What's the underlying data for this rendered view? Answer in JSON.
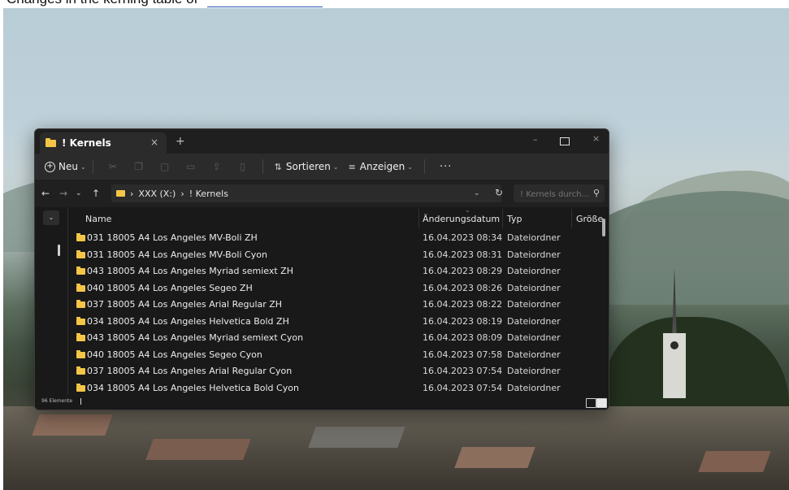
{
  "document": {
    "text": "Changes in the kerning table of"
  },
  "window": {
    "tab_title": "! Kernels",
    "tab_close": "×",
    "tab_add": "+",
    "minimize": "–",
    "close": "×"
  },
  "toolbar": {
    "new_label": "Neu",
    "sort_label": "Sortieren",
    "view_label": "Anzeigen",
    "more_label": "···"
  },
  "address": {
    "drive": "XXX (X:)",
    "folder": "! Kernels",
    "separator": "›",
    "search_placeholder": "! Kernels durch..."
  },
  "columns": {
    "name": "Name",
    "date": "Änderungsdatum",
    "type": "Typ",
    "size": "Größe"
  },
  "rows": [
    {
      "name": "031 18005 A4 Los Angeles MV-Boli ZH",
      "date": "16.04.2023 08:34",
      "type": "Dateiordner"
    },
    {
      "name": "031 18005 A4 Los Angeles MV-Boli Cyon",
      "date": "16.04.2023 08:31",
      "type": "Dateiordner"
    },
    {
      "name": "043 18005 A4 Los Angeles Myriad semiext ZH",
      "date": "16.04.2023 08:29",
      "type": "Dateiordner"
    },
    {
      "name": "040 18005 A4 Los Angeles Segeo ZH",
      "date": "16.04.2023 08:26",
      "type": "Dateiordner"
    },
    {
      "name": "037 18005 A4 Los Angeles Arial Regular ZH",
      "date": "16.04.2023 08:22",
      "type": "Dateiordner"
    },
    {
      "name": "034 18005 A4 Los Angeles Helvetica Bold ZH",
      "date": "16.04.2023 08:19",
      "type": "Dateiordner"
    },
    {
      "name": "043 18005 A4 Los Angeles Myriad semiext Cyon",
      "date": "16.04.2023 08:09",
      "type": "Dateiordner"
    },
    {
      "name": "040 18005 A4 Los Angeles Segeo Cyon",
      "date": "16.04.2023 07:58",
      "type": "Dateiordner"
    },
    {
      "name": "037 18005 A4 Los Angeles Arial Regular Cyon",
      "date": "16.04.2023 07:54",
      "type": "Dateiordner"
    },
    {
      "name": "034 18005 A4 Los Angeles Helvetica Bold Cyon",
      "date": "16.04.2023 07:54",
      "type": "Dateiordner"
    }
  ],
  "status": {
    "item_count": "96 Elemente"
  },
  "colors": {
    "folder": "#f5c548",
    "window_bg": "#191919",
    "toolbar_bg": "#2b2b2b",
    "link_underline": "#2c55b0"
  }
}
